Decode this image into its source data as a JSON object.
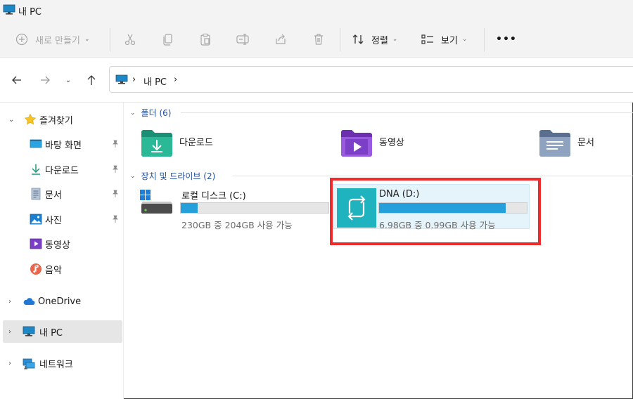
{
  "window": {
    "title": "내 PC"
  },
  "toolbar": {
    "new_label": "새로 만들기",
    "sort_label": "정렬",
    "view_label": "보기",
    "more_label": "•••"
  },
  "address": {
    "crumb1": "내 PC",
    "sep": "›"
  },
  "sidebar": {
    "quick_access": "즐겨찾기",
    "items": [
      {
        "label": "바탕 화면"
      },
      {
        "label": "다운로드"
      },
      {
        "label": "문서"
      },
      {
        "label": "사진"
      },
      {
        "label": "동영상"
      },
      {
        "label": "음악"
      }
    ],
    "onedrive": "OneDrive",
    "thispc": "내 PC",
    "network": "네트워크"
  },
  "folders_group": {
    "label": "폴더 (6)"
  },
  "folders": [
    {
      "label": "다운로드"
    },
    {
      "label": "동영상"
    },
    {
      "label": "문서"
    }
  ],
  "drives_group": {
    "label": "장치 및 드라이브 (2)"
  },
  "drives": [
    {
      "name": "로컬 디스크 (C:)",
      "info": "230GB 중 204GB 사용 가능",
      "used_fraction": 0.113
    },
    {
      "name": "DNA (D:)",
      "info": "6.98GB 중 0.99GB 사용 가능",
      "used_fraction": 0.858
    }
  ],
  "colors": {
    "accent": "#26a0da",
    "highlight": "#ef2b2b",
    "group_header": "#1f4e9b"
  }
}
